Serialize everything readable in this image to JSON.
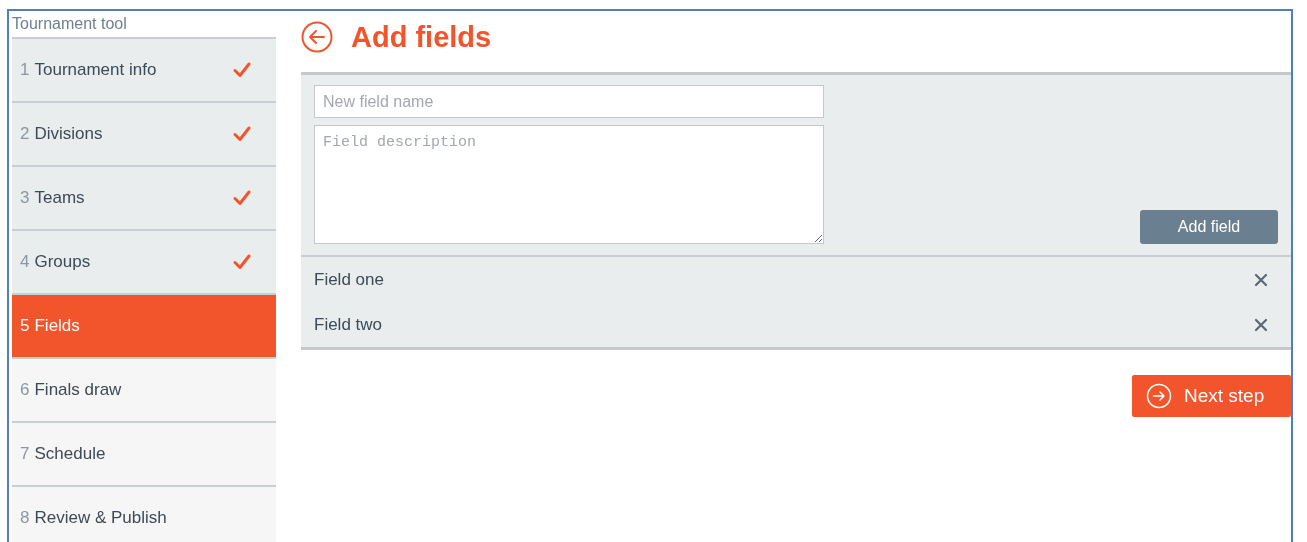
{
  "sidebar": {
    "title": "Tournament tool",
    "items": [
      {
        "number": "1",
        "label": "Tournament info",
        "done": true,
        "selected": false
      },
      {
        "number": "2",
        "label": "Divisions",
        "done": true,
        "selected": false
      },
      {
        "number": "3",
        "label": "Teams",
        "done": true,
        "selected": false
      },
      {
        "number": "4",
        "label": "Groups",
        "done": true,
        "selected": false
      },
      {
        "number": "5",
        "label": "Fields",
        "done": false,
        "selected": true
      },
      {
        "number": "6",
        "label": "Finals draw",
        "done": false,
        "selected": false
      },
      {
        "number": "7",
        "label": "Schedule",
        "done": false,
        "selected": false
      },
      {
        "number": "8",
        "label": "Review & Publish",
        "done": false,
        "selected": false
      }
    ]
  },
  "page": {
    "title": "Add fields"
  },
  "form": {
    "name": {
      "placeholder": "New field name"
    },
    "description": {
      "placeholder": "Field description"
    },
    "button": "Add field"
  },
  "fields": [
    {
      "name": "Field one"
    },
    {
      "name": "Field two"
    }
  ],
  "next_button": "Next step"
}
